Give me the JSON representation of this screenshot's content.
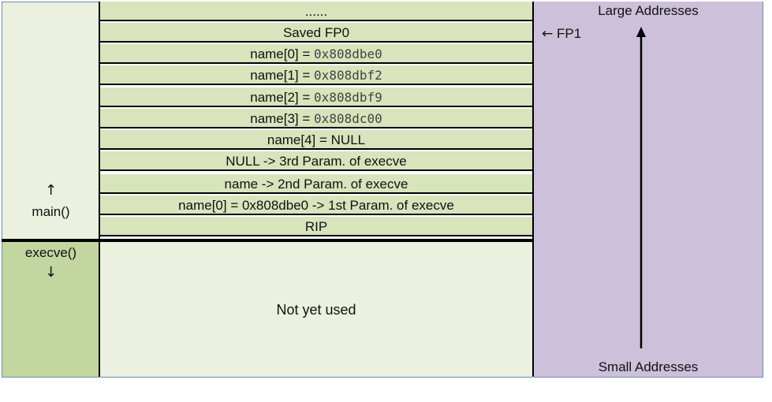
{
  "left": {
    "main_arrow": "↑",
    "main_label": "main()",
    "execve_label": "execve()",
    "execve_arrow": "↓"
  },
  "stack": {
    "rows": [
      {
        "text": "......",
        "mono": ""
      },
      {
        "text": "Saved FP0",
        "mono": ""
      },
      {
        "text": "name[0] = ",
        "mono": "0x808dbe0"
      },
      {
        "text": "name[1] = ",
        "mono": "0x808dbf2"
      },
      {
        "text": "name[2] = ",
        "mono": "0x808dbf9"
      },
      {
        "text": "name[3] = ",
        "mono": "0x808dc00"
      },
      {
        "text": "name[4] = NULL",
        "mono": ""
      },
      {
        "text": "NULL  -> 3rd Param. of execve",
        "mono": ""
      },
      {
        "text": "name -> 2nd Param. of execve",
        "mono": ""
      },
      {
        "text": "name[0] = 0x808dbe0 -> 1st Param. of execve",
        "mono": ""
      },
      {
        "text": "RIP",
        "mono": ""
      }
    ],
    "unused_label": "Not yet used"
  },
  "addresses": {
    "top_label": "Large Addresses",
    "bottom_label": "Small Addresses",
    "fp1_arrow": "←",
    "fp1_label": " FP1"
  },
  "colors": {
    "main_frame": "#ebf1de",
    "stack_row": "#d8e4bc",
    "execve_frame": "#c4d6a0",
    "address_column": "#ccc0da"
  }
}
